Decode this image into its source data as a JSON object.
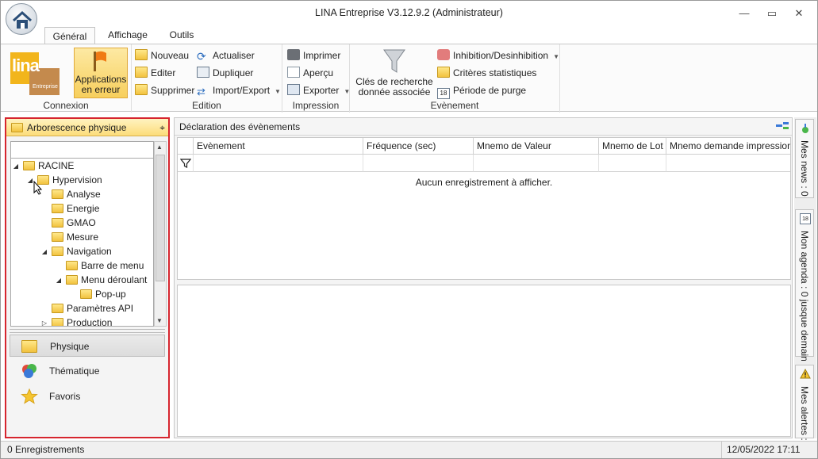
{
  "window": {
    "title": "LINA Entreprise  V3.12.9.2  (Administrateur)",
    "minimize": "—",
    "restore": "▭",
    "close": "✕"
  },
  "ribbon_tabs": [
    "Général",
    "Affichage",
    "Outils"
  ],
  "ribbon": {
    "connexion": {
      "app_button": "Applications en erreur",
      "label": "Connexion"
    },
    "edition": {
      "nouveau": "Nouveau",
      "editer": "Editer",
      "supprimer": "Supprimer",
      "actualiser": "Actualiser",
      "dupliquer": "Dupliquer",
      "import_export": "Import/Export",
      "label": "Edition"
    },
    "impression": {
      "imprimer": "Imprimer",
      "apercu": "Aperçu",
      "exporter": "Exporter",
      "label": "Impression"
    },
    "evenement": {
      "cles_line1": "Clés de recherche",
      "cles_line2": "donnée associée",
      "inhibition": "Inhibition/Desinhibition",
      "criteres": "Critères statistiques",
      "periode": "Période de purge",
      "label": "Evènement"
    }
  },
  "logo": {
    "brand": "lina",
    "sub": "Entreprise"
  },
  "left_panel": {
    "title": "Arborescence physique",
    "search_value": "",
    "tree": [
      {
        "label": "RACINE",
        "toggle": "◢"
      },
      {
        "label": "Hypervision",
        "toggle": "◢"
      },
      {
        "label": "Analyse",
        "toggle": ""
      },
      {
        "label": "Energie",
        "toggle": ""
      },
      {
        "label": "GMAO",
        "toggle": ""
      },
      {
        "label": "Mesure",
        "toggle": ""
      },
      {
        "label": "Navigation",
        "toggle": "◢"
      },
      {
        "label": "Barre de menu",
        "toggle": ""
      },
      {
        "label": "Menu déroulant",
        "toggle": "◢"
      },
      {
        "label": "Pop-up",
        "toggle": ""
      },
      {
        "label": "Paramètres API",
        "toggle": ""
      },
      {
        "label": "Production",
        "toggle": "▷"
      }
    ],
    "nav": [
      "Physique",
      "Thématique",
      "Favoris"
    ]
  },
  "main": {
    "title": "Déclaration des évènements",
    "columns": [
      "Evènement",
      "Fréquence (sec)",
      "Mnemo de Valeur",
      "Mnemo de Lot",
      "Mnemo demande impression"
    ],
    "empty_message": "Aucun enregistrement à afficher."
  },
  "right_sidebar": {
    "news": "Mes news : 0",
    "agenda": "Mon agenda : 0 jusque demain",
    "alerts": "Mes alertes :",
    "agenda_icon_num": "18"
  },
  "status": {
    "records": "0 Enregistrements",
    "datetime": "12/05/2022 17:11"
  },
  "colors": {
    "selection_border": "#d6252e",
    "highlight": "#f7cf5c",
    "folder": "#f2c23f"
  }
}
